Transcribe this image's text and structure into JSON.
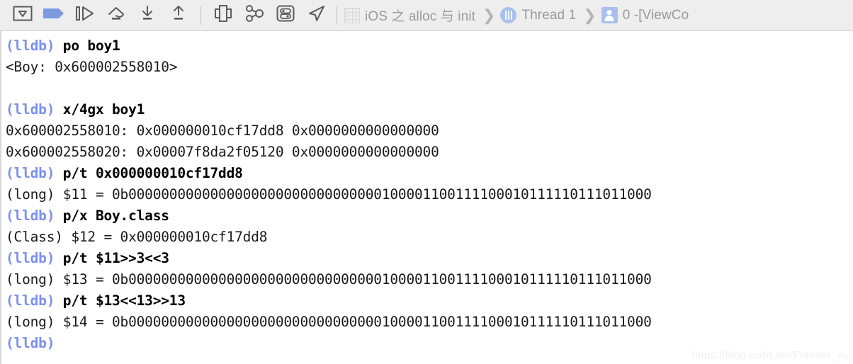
{
  "toolbar": {
    "buttons": [
      {
        "name": "hide-show-debug-area-button",
        "icon": "panel-toggle-icon",
        "label": "Hide/Show Debug Area"
      },
      {
        "name": "deactivate-breakpoints-button",
        "icon": "breakpoint-flag-icon",
        "label": "Deactivate Breakpoints"
      },
      {
        "name": "continue-program-button",
        "icon": "continue-icon",
        "label": "Continue program execution"
      },
      {
        "name": "step-over-button",
        "icon": "step-over-icon",
        "label": "Step over"
      },
      {
        "name": "step-into-button",
        "icon": "step-into-icon",
        "label": "Step into"
      },
      {
        "name": "step-out-button",
        "icon": "step-out-icon",
        "label": "Step out"
      },
      {
        "name": "debug-view-hierarchy-button",
        "icon": "view-hierarchy-icon",
        "label": "Debug View Hierarchy"
      },
      {
        "name": "memory-graph-button",
        "icon": "memory-graph-icon",
        "label": "Debug Memory Graph"
      },
      {
        "name": "environment-overrides-button",
        "icon": "environment-overrides-icon",
        "label": "Environment Overrides"
      },
      {
        "name": "simulate-location-button",
        "icon": "location-arrow-icon",
        "label": "Simulate Location"
      }
    ],
    "breadcrumb": [
      {
        "name": "breadcrumb-process",
        "icon": "process-grid-icon",
        "label": "iOS 之 alloc 与 init"
      },
      {
        "name": "breadcrumb-thread",
        "icon": "thread-icon",
        "label": "Thread 1"
      },
      {
        "name": "breadcrumb-frame",
        "icon": "stack-frame-icon",
        "label": "0 -[ViewCo"
      }
    ],
    "chevron": "❯"
  },
  "console": {
    "prompt": "(lldb)",
    "lines": [
      {
        "type": "command",
        "prompt": "(lldb) ",
        "text": "po boy1"
      },
      {
        "type": "output",
        "text": "<Boy: 0x600002558010>"
      },
      {
        "type": "blank",
        "text": " "
      },
      {
        "type": "command",
        "prompt": "(lldb) ",
        "text": "x/4gx boy1"
      },
      {
        "type": "output",
        "text": "0x600002558010: 0x000000010cf17dd8 0x0000000000000000"
      },
      {
        "type": "output",
        "text": "0x600002558020: 0x00007f8da2f05120 0x0000000000000000"
      },
      {
        "type": "command",
        "prompt": "(lldb) ",
        "text": "p/t 0x000000010cf17dd8"
      },
      {
        "type": "output",
        "text": "(long) $11 = 0b0000000000000000000000000000000100001100111100010111110111011000"
      },
      {
        "type": "command",
        "prompt": "(lldb) ",
        "text": "p/x Boy.class"
      },
      {
        "type": "output",
        "text": "(Class) $12 = 0x000000010cf17dd8"
      },
      {
        "type": "command",
        "prompt": "(lldb) ",
        "text": "p/t $11>>3<<3"
      },
      {
        "type": "output",
        "text": "(long) $13 = 0b0000000000000000000000000000000100001100111100010111110111011000"
      },
      {
        "type": "command",
        "prompt": "(lldb) ",
        "text": "p/t $13<<13>>13"
      },
      {
        "type": "output",
        "text": "(long) $14 = 0b0000000000000000000000000000000100001100111100010111110111011000"
      },
      {
        "type": "command",
        "prompt": "(lldb)",
        "text": ""
      }
    ],
    "watermark": "https://blog.csdn.net/Forever_wj"
  },
  "colors": {
    "prompt_blue": "#7b8ff0",
    "accent_blue": "#7b9ae0",
    "toolbar_bg": "#eeeeee",
    "text": "#1a1a1a"
  }
}
